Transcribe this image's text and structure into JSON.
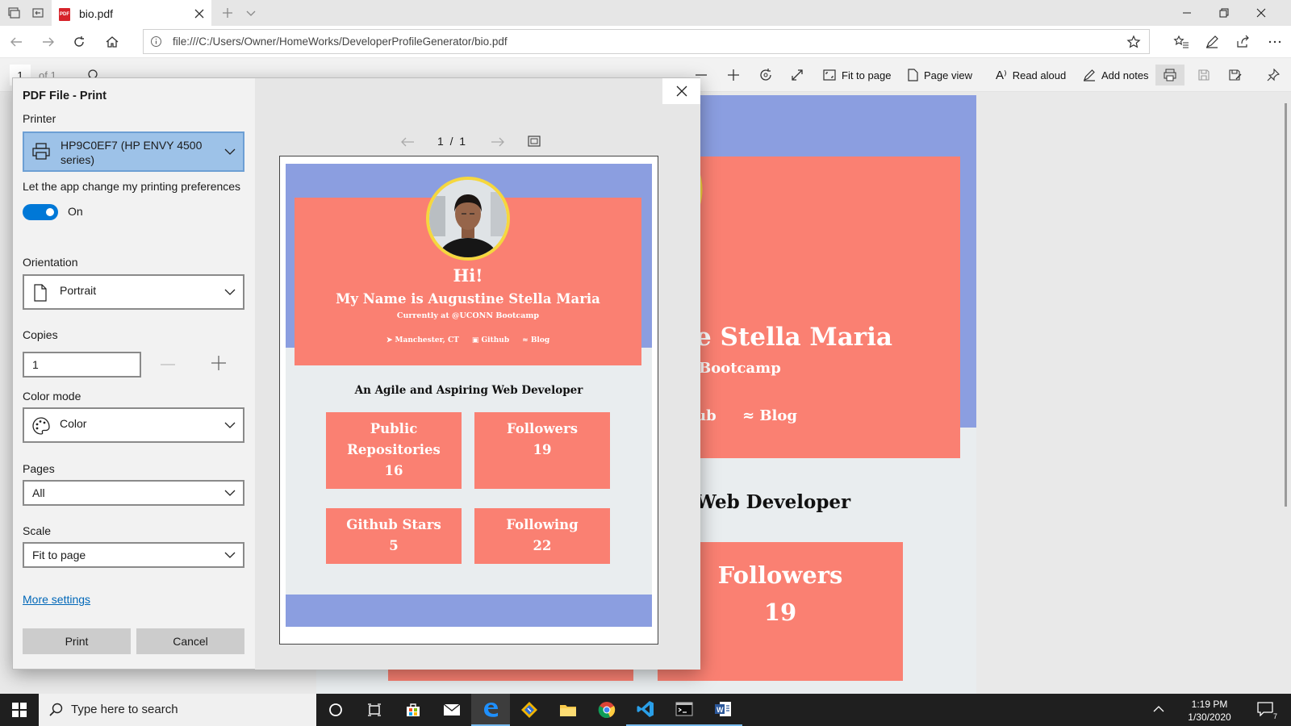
{
  "browser": {
    "tab_title": "bio.pdf",
    "url": "file:///C:/Users/Owner/HomeWorks/DeveloperProfileGenerator/bio.pdf"
  },
  "pdf_toolbar": {
    "page_number": "1",
    "page_of": "of 1",
    "fit_to_page": "Fit to page",
    "page_view": "Page view",
    "read_aloud": "Read aloud",
    "add_notes": "Add notes"
  },
  "background_page": {
    "name_fragment": "e Stella Maria",
    "bootcamp_fragment": "Bootcamp",
    "links_fragment_a": "ub",
    "links_fragment_b": "Blog",
    "tagline_fragment": "Web Developer",
    "followers_label": "Followers",
    "followers_value": "19"
  },
  "print_dialog": {
    "title": "PDF File - Print",
    "printer_label": "Printer",
    "printer_value": "HP9C0EF7 (HP ENVY 4500 series)",
    "preferences_label": "Let the app change my printing preferences",
    "preferences_toggle": "On",
    "orientation_label": "Orientation",
    "orientation_value": "Portrait",
    "copies_label": "Copies",
    "copies_value": "1",
    "color_mode_label": "Color mode",
    "color_mode_value": "Color",
    "pages_label": "Pages",
    "pages_value": "All",
    "scale_label": "Scale",
    "scale_value": "Fit to page",
    "more_settings": "More settings",
    "print_button": "Print",
    "cancel_button": "Cancel",
    "preview_page_indicator": "1  /  1"
  },
  "preview": {
    "greeting": "Hi!",
    "name_line": "My Name is Augustine Stella Maria",
    "current_line": "Currently at @UCONN Bootcamp",
    "location": "Manchester, CT",
    "github_link": "Github",
    "blog_link": "Blog",
    "tagline": "An Agile and Aspiring Web Developer",
    "cards": [
      {
        "label_line1": "Public",
        "label_line2": "Repositories",
        "value": "16"
      },
      {
        "label": "Followers",
        "value": "19"
      },
      {
        "label": "Github Stars",
        "value": "5"
      },
      {
        "label": "Following",
        "value": "22"
      }
    ]
  },
  "taskbar": {
    "search_placeholder": "Type here to search",
    "time": "1:19 PM",
    "date": "1/30/2020",
    "notification_count": "7"
  },
  "colors": {
    "coral": "#fa8072",
    "periwinkle": "#8b9ee0",
    "accent_blue": "#0078d7",
    "avatar_border": "#f5d73e"
  },
  "icons": [
    "tab-preview-icon",
    "tab-aside-icon",
    "pdf-icon",
    "close-icon",
    "new-tab-icon",
    "tab-list-chevron-icon",
    "minimize-icon",
    "restore-icon",
    "back-icon",
    "forward-icon",
    "refresh-icon",
    "home-icon",
    "info-icon",
    "star-icon",
    "favorites-icon",
    "pen-icon",
    "share-icon",
    "more-icon",
    "search-icon",
    "zoom-out-icon",
    "zoom-in-icon",
    "rotate-icon",
    "fullscreen-icon",
    "printer-icon",
    "save-icon",
    "save-as-icon",
    "pin-icon",
    "windows-start-icon",
    "task-view-icon",
    "edge-icon",
    "chrome-icon",
    "vscode-icon",
    "terminal-icon",
    "word-icon",
    "folder-icon",
    "store-icon",
    "mail-icon",
    "git-icon",
    "cortana-icon",
    "notification-icon",
    "chevron-up-icon"
  ]
}
